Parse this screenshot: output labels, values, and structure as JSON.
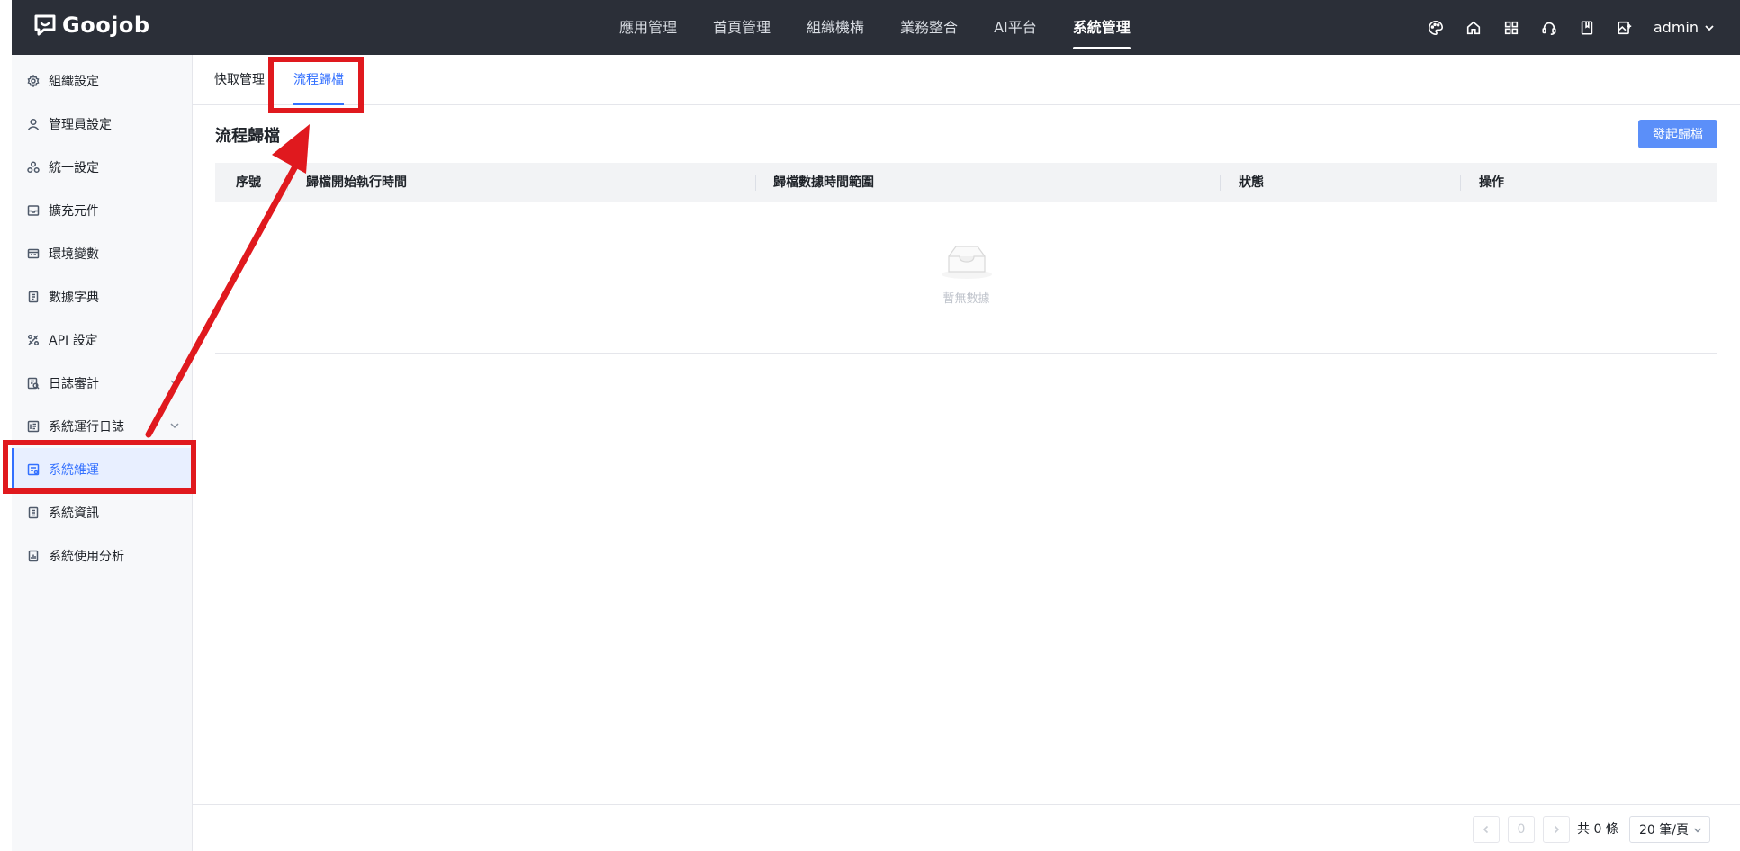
{
  "app": {
    "logo_text": "Goojob"
  },
  "topnav": {
    "items": [
      {
        "label": "應用管理"
      },
      {
        "label": "首頁管理"
      },
      {
        "label": "組織機構"
      },
      {
        "label": "業務整合"
      },
      {
        "label": "AI平台"
      },
      {
        "label": "系統管理",
        "active": true
      }
    ]
  },
  "header": {
    "icons": [
      "palette-icon",
      "home-icon",
      "apps-grid-icon",
      "headset-icon",
      "book-icon",
      "image-edit-icon"
    ],
    "user": "admin"
  },
  "sidebar": {
    "items": [
      {
        "label": "組織設定",
        "icon": "gear-icon"
      },
      {
        "label": "管理員設定",
        "icon": "user-icon"
      },
      {
        "label": "統一設定",
        "icon": "cluster-icon"
      },
      {
        "label": "擴充元件",
        "icon": "inbox-icon"
      },
      {
        "label": "環境變數",
        "icon": "env-icon"
      },
      {
        "label": "數據字典",
        "icon": "dictionary-icon"
      },
      {
        "label": "API 設定",
        "icon": "api-icon"
      },
      {
        "label": "日誌審計",
        "icon": "audit-icon"
      },
      {
        "label": "系統運行日誌",
        "icon": "log-icon"
      },
      {
        "label": "系統維運",
        "icon": "maintenance-icon",
        "active": true
      },
      {
        "label": "系統資訊",
        "icon": "info-doc-icon"
      },
      {
        "label": "系統使用分析",
        "icon": "analysis-icon"
      }
    ]
  },
  "tabs": [
    {
      "label": "快取管理"
    },
    {
      "label": "流程歸檔",
      "active": true
    }
  ],
  "main": {
    "title": "流程歸檔",
    "action_button": "發起歸檔",
    "columns": [
      "序號",
      "歸檔開始執行時間",
      "歸檔數據時間範圍",
      "狀態",
      "操作"
    ],
    "empty_text": "暫無數據"
  },
  "pagination": {
    "current_page": "0",
    "total": "共 0 條",
    "page_size": "20 筆/頁"
  },
  "colors": {
    "header_bg": "#2b2f38",
    "accent": "#3370ff",
    "primary_button": "#5b8ff9",
    "annotation": "#e0191e"
  }
}
